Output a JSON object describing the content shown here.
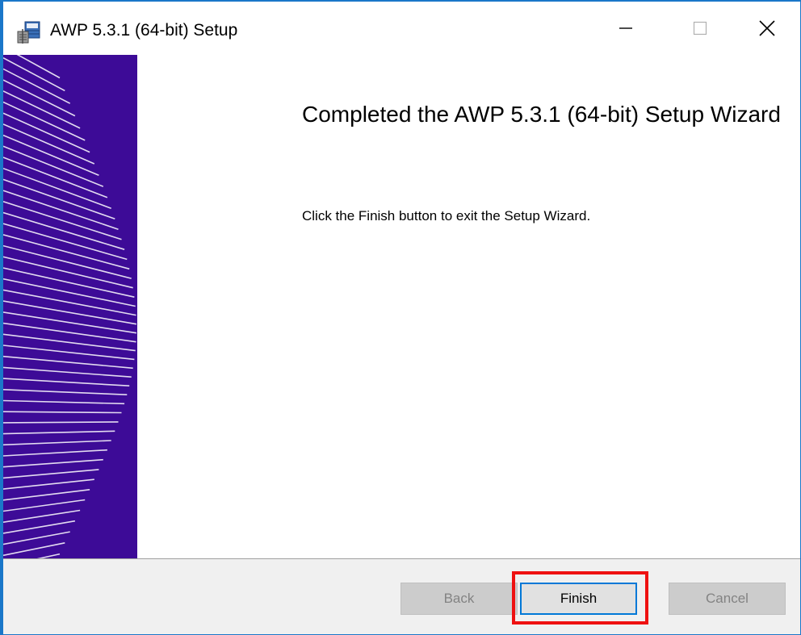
{
  "window": {
    "title": "AWP 5.3.1 (64-bit) Setup",
    "icon": "installer-package-icon",
    "controls": [
      "minimize-icon",
      "maximize-icon",
      "close-icon"
    ]
  },
  "wizard": {
    "heading": "Completed the AWP 5.3.1 (64-bit) Setup Wizard",
    "message": "Click the Finish button to exit the Setup Wizard."
  },
  "buttons": {
    "back_label": "Back",
    "finish_label": "Finish",
    "cancel_label": "Cancel"
  },
  "colors": {
    "side_panel": "#3d0b97",
    "focus_border": "#0078d7",
    "highlight": "#ee1111",
    "window_border": "#1a77c9"
  }
}
